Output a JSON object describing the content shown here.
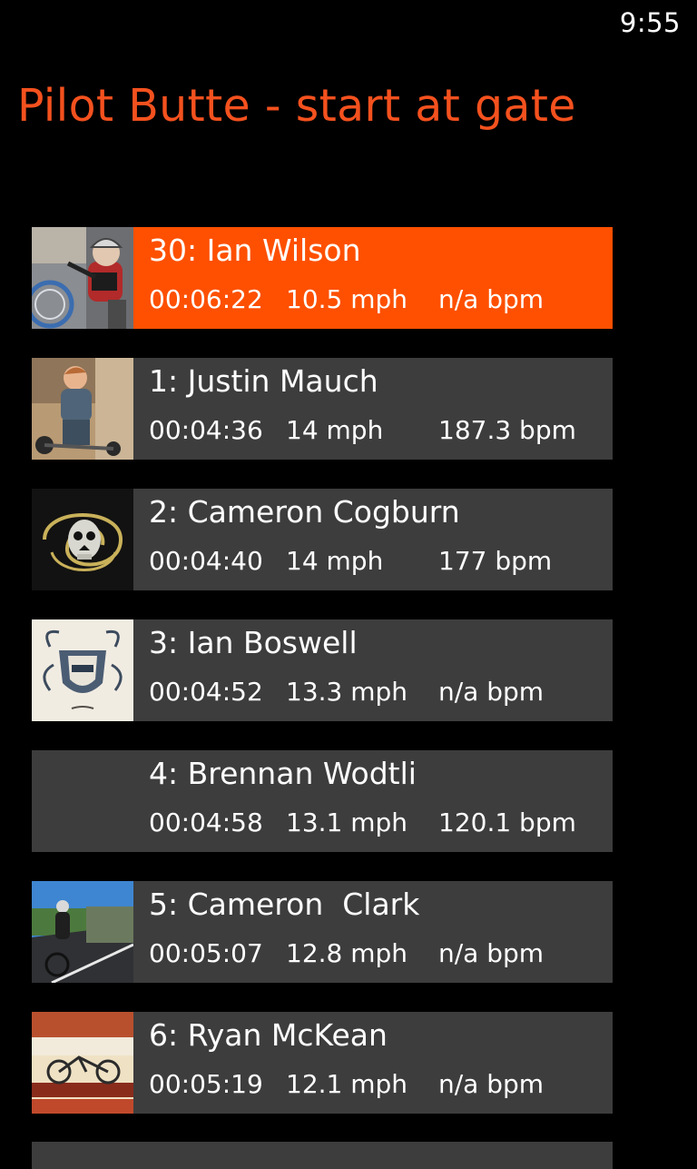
{
  "status_bar": {
    "time": "9:55"
  },
  "page": {
    "title": "Pilot Butte - start at gate"
  },
  "colors": {
    "accent": "#f4511e",
    "selected_row": "#fe5000",
    "row_bg": "#3d3d3d",
    "background": "#000000"
  },
  "riders": [
    {
      "name": "30: Ian Wilson",
      "time": "00:06:22",
      "speed": "10.5 mph",
      "heart_rate": "n/a bpm",
      "selected": true,
      "thumbnail": "kid-cyclist-photo"
    },
    {
      "name": "1: Justin Mauch",
      "time": "00:04:36",
      "speed": "14 mph",
      "heart_rate": "187.3 bpm",
      "selected": false,
      "thumbnail": "child-on-bike-photo"
    },
    {
      "name": "2: Cameron Cogburn",
      "time": "00:04:40",
      "speed": "14 mph",
      "heart_rate": "177 bpm",
      "selected": false,
      "thumbnail": "snake-skull-art"
    },
    {
      "name": "3: Ian Boswell",
      "time": "00:04:52",
      "speed": "13.3 mph",
      "heart_rate": "n/a bpm",
      "selected": false,
      "thumbnail": "crest-sketch"
    },
    {
      "name": "4: Brennan Wodtli",
      "time": "00:04:58",
      "speed": "13.1 mph",
      "heart_rate": "120.1 bpm",
      "selected": false,
      "thumbnail": "none"
    },
    {
      "name": "5: Cameron  Clark",
      "time": "00:05:07",
      "speed": "12.8 mph",
      "heart_rate": "n/a bpm",
      "selected": false,
      "thumbnail": "road-cyclist-photo"
    },
    {
      "name": "6: Ryan McKean",
      "time": "00:05:19",
      "speed": "12.1 mph",
      "heart_rate": "n/a bpm",
      "selected": false,
      "thumbnail": "beer-can-photo"
    }
  ]
}
